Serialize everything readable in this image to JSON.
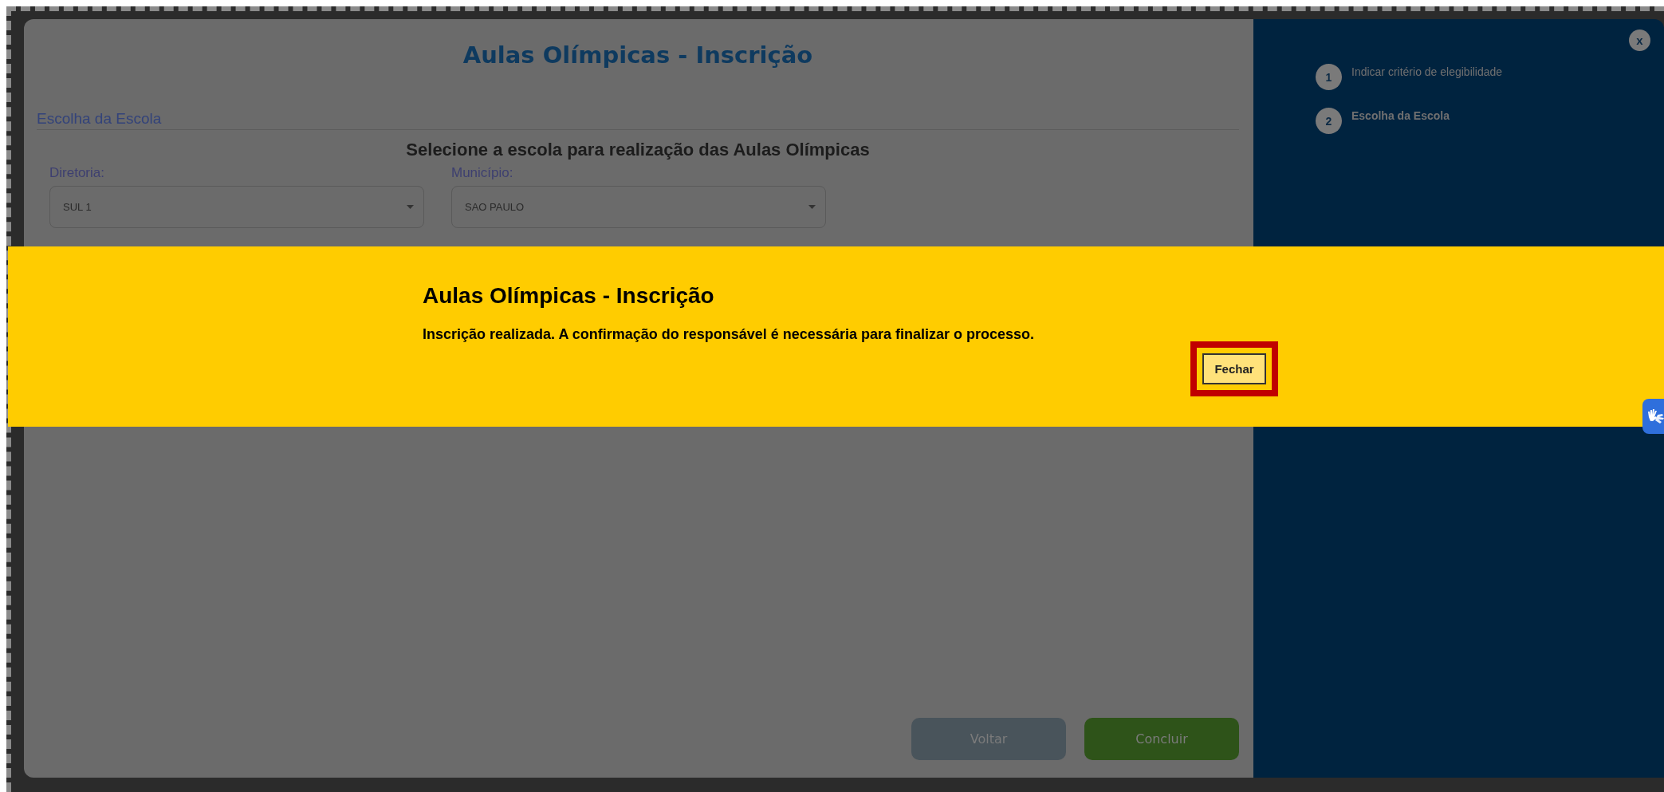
{
  "modal": {
    "title": "Aulas Olímpicas - Inscrição",
    "section": "Escolha da Escola",
    "heading": "Selecione a escola para realização das Aulas Olímpicas",
    "fields": [
      {
        "label": "Diretoria:",
        "value": "SUL 1"
      },
      {
        "label": "Município:",
        "value": "SAO PAULO"
      }
    ],
    "buttons": [
      {
        "label": "Voltar",
        "kind": "secondary"
      },
      {
        "label": "Concluir",
        "kind": "primary"
      }
    ],
    "steps": [
      {
        "number": "1",
        "label": "Indicar critério de elegibilidade"
      },
      {
        "number": "2",
        "label": "Escolha da Escola"
      }
    ],
    "close": "x"
  },
  "alert": {
    "title": "Aulas Olímpicas - Inscrição",
    "message": "Inscrição realizada. A confirmação do responsável é necessária para finalizar o processo.",
    "button": "Fechar"
  }
}
